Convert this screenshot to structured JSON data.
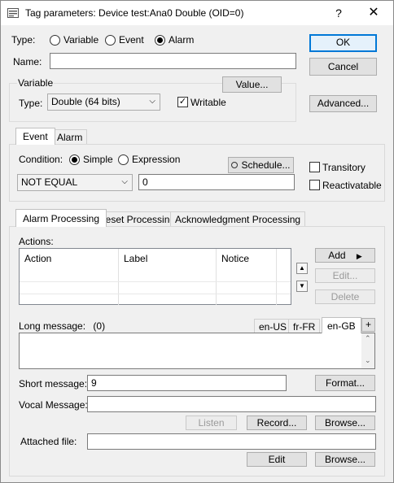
{
  "window": {
    "title": "Tag parameters: Device test:Ana0 Double (OID=0)",
    "help_glyph": "?",
    "close_glyph": "✕"
  },
  "type_row": {
    "label": "Type:",
    "options": [
      "Variable",
      "Event",
      "Alarm"
    ],
    "selected": "Alarm"
  },
  "name": {
    "label": "Name:",
    "value": ""
  },
  "buttons": {
    "ok": "OK",
    "cancel": "Cancel",
    "advanced": "Advanced...",
    "value": "Value..."
  },
  "variable_group": {
    "title": "Variable",
    "type_label": "Type:",
    "type_value": "Double (64 bits)",
    "writable_label": "Writable",
    "writable_checked": true
  },
  "event_tabs": [
    "Event",
    "Alarm"
  ],
  "event_panel": {
    "condition_label": "Condition:",
    "simple_label": "Simple",
    "expression_label": "Expression",
    "condition_selected": "Simple",
    "schedule_label": "Schedule...",
    "operator": "NOT EQUAL",
    "compare_value": "0",
    "transitory_label": "Transitory",
    "reactivatable_label": "Reactivatable",
    "transitory_checked": false,
    "reactivatable_checked": false
  },
  "processing_tabs": [
    "Alarm Processing",
    "Reset Processing",
    "Acknowledgment Processing"
  ],
  "actions": {
    "label": "Actions:",
    "columns": [
      "Action",
      "Label",
      "Notice"
    ],
    "rows": [],
    "add": "Add",
    "edit": "Edit...",
    "delete": "Delete"
  },
  "long_message": {
    "label": "Long message:",
    "count": "(0)",
    "languages": [
      "en-US",
      "fr-FR",
      "en-GB"
    ],
    "active_language": "en-GB",
    "add_glyph": "+",
    "value": ""
  },
  "short_message": {
    "label": "Short message:",
    "value": "9",
    "format": "Format..."
  },
  "vocal_message": {
    "label": "Vocal Message:",
    "value": "",
    "listen": "Listen",
    "record": "Record...",
    "browse": "Browse..."
  },
  "attached_file": {
    "label": "Attached file:",
    "value": "",
    "edit": "Edit",
    "browse": "Browse..."
  }
}
